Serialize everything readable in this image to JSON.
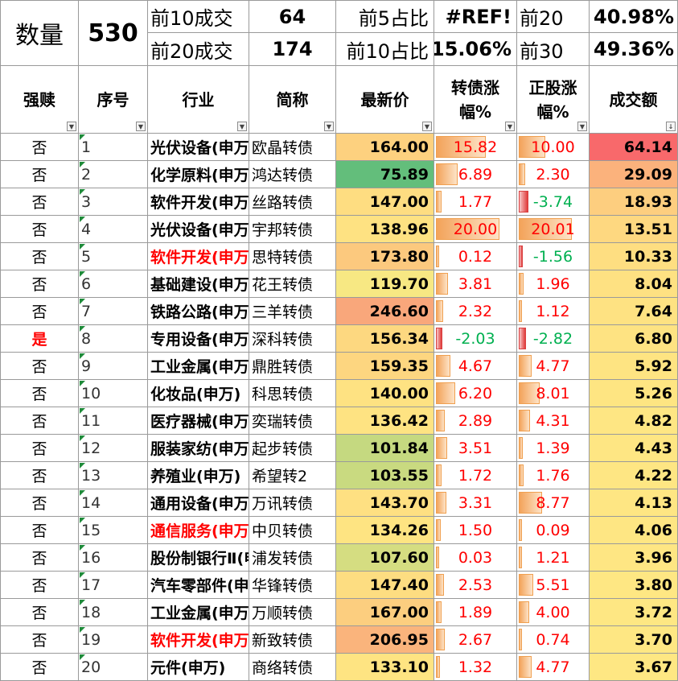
{
  "summary": {
    "count_label": "数量",
    "count_value": "530",
    "top10_label": "前10成交",
    "top10_value": "64",
    "top20_label": "前20成交",
    "top20_value": "174",
    "top5pct_label": "前5占比",
    "top5pct_value": "#REF!",
    "top10pct_label": "前10占比",
    "top10pct_value": "15.06%",
    "top20_share_label": "前20",
    "top20_share_value": "40.98%",
    "top30_share_label": "前30",
    "top30_share_value": "49.36%"
  },
  "headers": {
    "redeem": "强赎",
    "seq": "序号",
    "industry": "行业",
    "name": "简称",
    "price": "最新价",
    "bond_chg": "转债涨幅%",
    "stock_chg": "正股涨幅%",
    "turnover": "成交额"
  },
  "colors": {
    "green_text": "#00b050",
    "red_text": "#ff0000"
  },
  "chart_data": {
    "type": "table",
    "columns": [
      "强赎",
      "序号",
      "行业",
      "简称",
      "最新价",
      "转债涨幅%",
      "正股涨幅%",
      "成交额"
    ],
    "rows": [
      {
        "redeem": "否",
        "seq": "1",
        "industry": "光伏设备(申万)",
        "name": "欧晶转债",
        "price": "164.00",
        "price_color": "#fdd17f",
        "bond": "15.82",
        "bond_num": 15.82,
        "stock": "10.00",
        "stock_num": 10.0,
        "turnover": "64.14",
        "turnover_color": "#f8696b",
        "industry_red": false
      },
      {
        "redeem": "否",
        "seq": "2",
        "industry": "化学原料(申万)",
        "name": "鸿达转债",
        "price": "75.89",
        "price_color": "#63be7b",
        "bond": "6.89",
        "bond_num": 6.89,
        "stock": "2.30",
        "stock_num": 2.3,
        "turnover": "29.09",
        "turnover_color": "#fbb27c",
        "industry_red": false
      },
      {
        "redeem": "否",
        "seq": "3",
        "industry": "软件开发(申万)",
        "name": "丝路转债",
        "price": "147.00",
        "price_color": "#fedd81",
        "bond": "1.77",
        "bond_num": 1.77,
        "stock": "-3.74",
        "stock_num": -3.74,
        "turnover": "18.93",
        "turnover_color": "#fdce7f",
        "industry_red": false
      },
      {
        "redeem": "否",
        "seq": "4",
        "industry": "光伏设备(申万)",
        "name": "宇邦转债",
        "price": "138.96",
        "price_color": "#fee282",
        "bond": "20.00",
        "bond_num": 20.0,
        "stock": "20.01",
        "stock_num": 20.01,
        "turnover": "13.51",
        "turnover_color": "#fed880",
        "industry_red": false
      },
      {
        "redeem": "否",
        "seq": "5",
        "industry": "软件开发(申万)",
        "name": "思特转债",
        "price": "173.80",
        "price_color": "#fcc97e",
        "bond": "0.12",
        "bond_num": 0.12,
        "stock": "-1.56",
        "stock_num": -1.56,
        "turnover": "10.33",
        "turnover_color": "#fede81",
        "industry_red": true
      },
      {
        "redeem": "否",
        "seq": "6",
        "industry": "基础建设(申万)",
        "name": "花王转债",
        "price": "119.70",
        "price_color": "#f7e883",
        "bond": "3.81",
        "bond_num": 3.81,
        "stock": "1.96",
        "stock_num": 1.96,
        "turnover": "8.04",
        "turnover_color": "#fee182",
        "industry_red": false
      },
      {
        "redeem": "否",
        "seq": "7",
        "industry": "铁路公路(申万)",
        "name": "三羊转债",
        "price": "246.60",
        "price_color": "#f9a77b",
        "bond": "2.32",
        "bond_num": 2.32,
        "stock": "1.12",
        "stock_num": 1.12,
        "turnover": "7.64",
        "turnover_color": "#fee282",
        "industry_red": false
      },
      {
        "redeem": "是",
        "seq": "8",
        "industry": "专用设备(申万)",
        "name": "深科转债",
        "price": "156.34",
        "price_color": "#fdd880",
        "bond": "-2.03",
        "bond_num": -2.03,
        "stock": "-2.82",
        "stock_num": -2.82,
        "turnover": "6.80",
        "turnover_color": "#fee382",
        "industry_red": false
      },
      {
        "redeem": "否",
        "seq": "9",
        "industry": "工业金属(申万)",
        "name": "鼎胜转债",
        "price": "159.35",
        "price_color": "#fdd680",
        "bond": "4.67",
        "bond_num": 4.67,
        "stock": "4.77",
        "stock_num": 4.77,
        "turnover": "5.92",
        "turnover_color": "#fee482",
        "industry_red": false
      },
      {
        "redeem": "否",
        "seq": "10",
        "industry": "化妆品(申万)",
        "name": "科思转债",
        "price": "140.00",
        "price_color": "#fee282",
        "bond": "6.20",
        "bond_num": 6.2,
        "stock": "8.01",
        "stock_num": 8.01,
        "turnover": "5.26",
        "turnover_color": "#fee582",
        "industry_red": false
      },
      {
        "redeem": "否",
        "seq": "11",
        "industry": "医疗器械(申万)",
        "name": "奕瑞转债",
        "price": "136.42",
        "price_color": "#fee382",
        "bond": "2.89",
        "bond_num": 2.89,
        "stock": "4.31",
        "stock_num": 4.31,
        "turnover": "4.82",
        "turnover_color": "#fee683",
        "industry_red": false
      },
      {
        "redeem": "否",
        "seq": "12",
        "industry": "服装家纺(申万)",
        "name": "起步转债",
        "price": "101.84",
        "price_color": "#c5d980",
        "bond": "3.51",
        "bond_num": 3.51,
        "stock": "1.39",
        "stock_num": 1.39,
        "turnover": "4.43",
        "turnover_color": "#fee683",
        "industry_red": false
      },
      {
        "redeem": "否",
        "seq": "13",
        "industry": "养殖业(申万)",
        "name": "希望转2",
        "price": "103.55",
        "price_color": "#c9da80",
        "bond": "1.72",
        "bond_num": 1.72,
        "stock": "1.76",
        "stock_num": 1.76,
        "turnover": "4.22",
        "turnover_color": "#fee683",
        "industry_red": false
      },
      {
        "redeem": "否",
        "seq": "14",
        "industry": "通用设备(申万)",
        "name": "万讯转债",
        "price": "143.70",
        "price_color": "#fee082",
        "bond": "3.31",
        "bond_num": 3.31,
        "stock": "8.77",
        "stock_num": 8.77,
        "turnover": "4.13",
        "turnover_color": "#fee683",
        "industry_red": false
      },
      {
        "redeem": "否",
        "seq": "15",
        "industry": "通信服务(申万)",
        "name": "中贝转债",
        "price": "134.26",
        "price_color": "#fee482",
        "bond": "1.50",
        "bond_num": 1.5,
        "stock": "0.09",
        "stock_num": 0.09,
        "turnover": "4.06",
        "turnover_color": "#fee683",
        "industry_red": true
      },
      {
        "redeem": "否",
        "seq": "16",
        "industry": "股份制银行Ⅱ(申万)",
        "name": "浦发转债",
        "price": "107.60",
        "price_color": "#d5dd81",
        "bond": "0.03",
        "bond_num": 0.03,
        "stock": "1.21",
        "stock_num": 1.21,
        "turnover": "3.96",
        "turnover_color": "#fee683",
        "industry_red": false
      },
      {
        "redeem": "否",
        "seq": "17",
        "industry": "汽车零部件(申万)",
        "name": "华锋转债",
        "price": "147.40",
        "price_color": "#fddd81",
        "bond": "2.53",
        "bond_num": 2.53,
        "stock": "5.51",
        "stock_num": 5.51,
        "turnover": "3.80",
        "turnover_color": "#fee783",
        "industry_red": false
      },
      {
        "redeem": "否",
        "seq": "18",
        "industry": "工业金属(申万)",
        "name": "万顺转债",
        "price": "167.00",
        "price_color": "#fcce7f",
        "bond": "1.89",
        "bond_num": 1.89,
        "stock": "4.00",
        "stock_num": 4.0,
        "turnover": "3.72",
        "turnover_color": "#fee783",
        "industry_red": false
      },
      {
        "redeem": "否",
        "seq": "19",
        "industry": "软件开发(申万)",
        "name": "新致转债",
        "price": "206.95",
        "price_color": "#fab47c",
        "bond": "2.67",
        "bond_num": 2.67,
        "stock": "0.74",
        "stock_num": 0.74,
        "turnover": "3.70",
        "turnover_color": "#fee783",
        "industry_red": true
      },
      {
        "redeem": "否",
        "seq": "20",
        "industry": "元件(申万)",
        "name": "商络转债",
        "price": "133.10",
        "price_color": "#fee482",
        "bond": "1.32",
        "bond_num": 1.32,
        "stock": "4.77",
        "stock_num": 4.77,
        "turnover": "3.67",
        "turnover_color": "#fee783",
        "industry_red": false
      }
    ]
  }
}
